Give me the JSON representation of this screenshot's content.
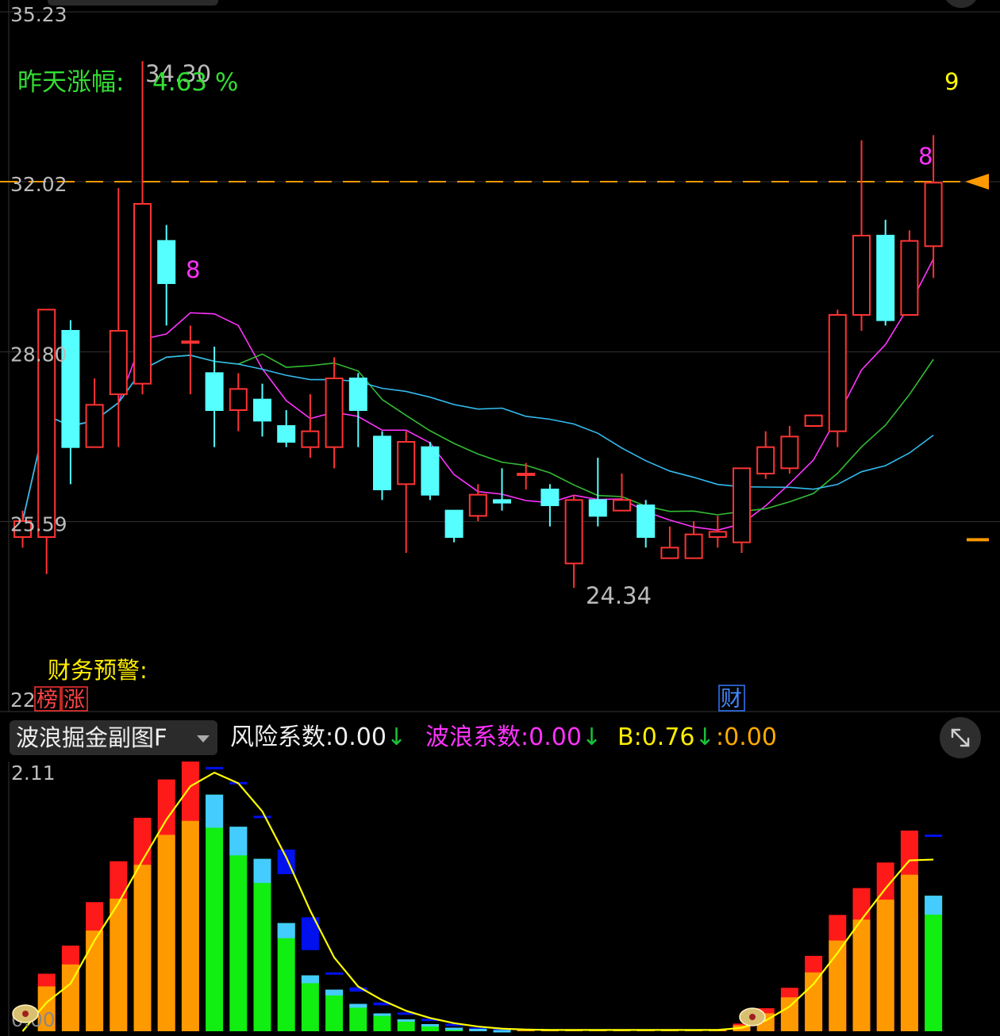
{
  "main_chart": {
    "price_labels": [
      "35.23",
      "32.02",
      "28.80",
      "25.59",
      "22"
    ],
    "high_label": "34.30",
    "low_label": "24.34",
    "yesterday_change_label": "昨天涨幅:",
    "yesterday_change_value": "4.63 %",
    "finance_warning_label": "财务预警:",
    "tag_bang": "榜",
    "tag_zhang": "涨",
    "tag_cai": "财",
    "marker_8_first": "8",
    "marker_8_second": "8",
    "marker_9": "9"
  },
  "sub_chart": {
    "indicator_name": "波浪掘金副图F",
    "risk_label": "风险系数:",
    "risk_value": "0.00",
    "wave_label": "波浪系数:",
    "wave_value": "0.00",
    "b_label": "B:",
    "b_value": "0.76",
    "extra_label": ":",
    "extra_value": "0.00",
    "arrow": "↓",
    "top_label": "2.11",
    "bottom_label": "0.00"
  },
  "colors": {
    "up": "#ff3333",
    "down": "#55ffff",
    "ma5": "#ff33ff",
    "ma10": "#33bb33",
    "ma20": "#33bbee",
    "orange": "#ff9900",
    "yellow": "#ffff00",
    "green_text": "#33dd33",
    "magenta_text": "#ff33ff"
  },
  "chart_data": [
    {
      "type": "candlestick",
      "ylim": [
        22,
        35.23
      ],
      "reference_line": 32.02,
      "ohlc": [
        [
          25.3,
          25.6,
          25.1,
          25.8
        ],
        [
          25.3,
          29.6,
          24.6,
          29.6
        ],
        [
          29.2,
          27.0,
          26.3,
          29.4
        ],
        [
          27.0,
          27.8,
          27.0,
          28.3
        ],
        [
          28.0,
          29.2,
          27.0,
          31.9
        ],
        [
          28.2,
          31.6,
          28.0,
          34.3
        ],
        [
          30.9,
          30.1,
          29.3,
          31.2
        ],
        [
          29.0,
          29.0,
          28.0,
          29.3
        ],
        [
          28.4,
          27.7,
          27.0,
          28.9
        ],
        [
          27.7,
          28.1,
          27.3,
          28.4
        ],
        [
          27.9,
          27.5,
          27.2,
          28.2
        ],
        [
          27.4,
          27.1,
          27.0,
          27.7
        ],
        [
          27.0,
          27.3,
          26.8,
          28.0
        ],
        [
          27.0,
          28.3,
          26.6,
          28.7
        ],
        [
          28.3,
          27.7,
          27.0,
          28.4
        ],
        [
          27.2,
          26.2,
          26.0,
          27.3
        ],
        [
          26.3,
          27.1,
          25.0,
          27.3
        ],
        [
          27.0,
          26.1,
          26.0,
          27.1
        ],
        [
          25.8,
          25.3,
          25.2,
          25.8
        ],
        [
          25.7,
          26.1,
          25.6,
          26.3
        ],
        [
          26.0,
          25.95,
          25.8,
          26.6
        ],
        [
          26.5,
          26.5,
          26.2,
          26.7
        ],
        [
          26.2,
          25.9,
          25.5,
          26.3
        ],
        [
          24.8,
          26.0,
          24.34,
          26.1
        ],
        [
          26.0,
          25.7,
          25.5,
          26.8
        ],
        [
          25.8,
          26.0,
          25.8,
          26.5
        ],
        [
          25.9,
          25.3,
          25.1,
          26.0
        ],
        [
          24.9,
          25.1,
          24.9,
          25.5
        ],
        [
          24.9,
          25.35,
          24.9,
          25.6
        ],
        [
          25.3,
          25.4,
          25.1,
          25.7
        ],
        [
          25.2,
          26.6,
          25.0,
          26.6
        ],
        [
          26.5,
          27.0,
          26.4,
          27.3
        ],
        [
          26.6,
          27.2,
          26.5,
          27.4
        ],
        [
          27.4,
          27.6,
          27.4,
          27.6
        ],
        [
          27.3,
          29.5,
          27.0,
          29.6
        ],
        [
          29.5,
          31.0,
          29.2,
          32.8
        ],
        [
          31.0,
          29.4,
          29.3,
          31.3
        ],
        [
          29.5,
          30.9,
          29.6,
          31.1
        ],
        [
          30.8,
          32.0,
          30.2,
          32.9
        ]
      ]
    },
    {
      "type": "bar",
      "ylim": [
        0,
        2.11
      ],
      "values": [
        0,
        0.45,
        0.67,
        1.01,
        1.33,
        1.67,
        1.97,
        2.11,
        1.99,
        1.72,
        1.45,
        0.91,
        0.47,
        0.35,
        0.23,
        0.15,
        0.1,
        0.06,
        0.03,
        0.02,
        0.01,
        0.01,
        0.01,
        0.01,
        0.01,
        0.01,
        0.01,
        0.01,
        0.01,
        0.01,
        0.06,
        0.18,
        0.34,
        0.59,
        0.91,
        1.12,
        1.32,
        1.57,
        1.14
      ]
    }
  ]
}
